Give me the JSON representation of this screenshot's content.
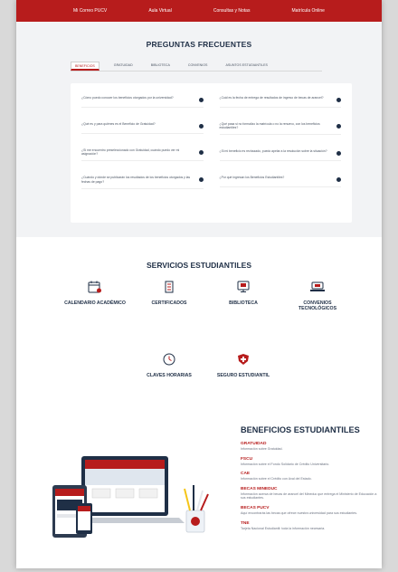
{
  "topnav": {
    "items": [
      "Mi Correo PUCV",
      "Aula Virtual",
      "Consultas y Notas",
      "Matrícula Online"
    ]
  },
  "faq": {
    "title": "PREGUNTAS FRECUENTES",
    "tabs": [
      "BENEFICIOS",
      "GRATUIDAD",
      "BIBLIOTECA",
      "CONVENIOS",
      "ASUNTOS ESTUDIANTILES"
    ],
    "left": [
      "¿Cómo puedo conocer los beneficios otorgados por la universidad?",
      "¿Qué es y para quiénes es el Beneficio de Gratuidad?",
      "¿Si me encuentro preseleccionado con Gratuidad, cuándo puedo ver mi asignación?",
      "¿Cuándo y dónde se publicarán los resultados de los beneficios otorgados y las fechas de pago?"
    ],
    "right": [
      "¿Cuál es la fecha de entrega de resultados de ingreso de becas de arancel?",
      "¿Qué pasa si no formalizo la matrícula o no la renuevo, con los beneficios estudiantiles?",
      "¿Si mi beneficio es rechazado, puedo apelar a la resolución sobre la situación?",
      "¿Por qué ingresan los Beneficios Estudiantiles?"
    ]
  },
  "services": {
    "title": "SERVICIOS ESTUDIANTILES",
    "items": [
      {
        "label": "CALENDARIO ACADÉMICO",
        "icon": "calendar-icon"
      },
      {
        "label": "CERTIFICADOS",
        "icon": "document-icon"
      },
      {
        "label": "BIBLIOTECA",
        "icon": "monitor-icon"
      },
      {
        "label": "CONVENIOS TECNOLÓGICOS",
        "icon": "laptop-icon"
      },
      {
        "label": "CLAVES HORARIAS",
        "icon": "clock-icon"
      },
      {
        "label": "SEGURO ESTUDIANTIL",
        "icon": "medical-shield-icon"
      }
    ]
  },
  "benefits": {
    "title": "BENEFICIOS ESTUDIANTILES",
    "items": [
      {
        "title": "GRATUIDAD",
        "desc": "Información sobre Gratuidad."
      },
      {
        "title": "FSCU",
        "desc": "Información sobre el Fondo Solidario de Crédito Universitario."
      },
      {
        "title": "CAE",
        "desc": "Información sobre el Crédito con Aval del Estado."
      },
      {
        "title": "BECAS MINEDUC",
        "desc": "Información acerca de becas de arancel del Mineduc que entrega el Ministerio de Educación a sus estudiantes."
      },
      {
        "title": "BECAS PUCV",
        "desc": "Aquí encontrarás las becas que ofrece nuestra universidad para sus estudiantes."
      },
      {
        "title": "TNE",
        "desc": "Tarjeta Nacional Estudiantil: toda la información necesaria."
      }
    ]
  },
  "colors": {
    "brand_red": "#b71c1c",
    "navy": "#1f2f46"
  }
}
